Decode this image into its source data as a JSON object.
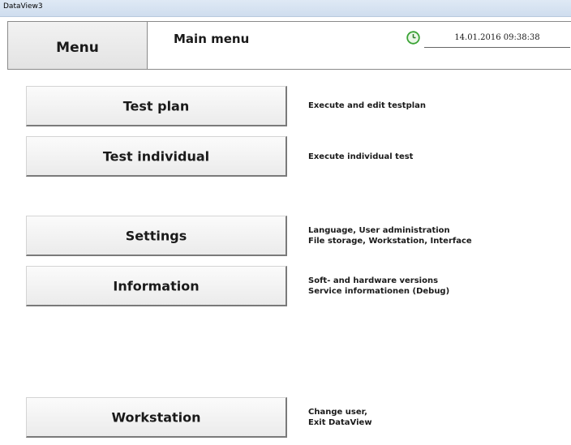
{
  "window": {
    "title": "DataView3"
  },
  "header": {
    "menu_label": "Menu",
    "title": "Main menu",
    "datetime": "14.01.2016  09:38:38"
  },
  "buttons": [
    {
      "label": "Test plan",
      "desc": [
        "Execute and edit testplan"
      ]
    },
    {
      "label": "Test individual",
      "desc": [
        "Execute individual test"
      ]
    },
    {
      "label": "Settings",
      "desc": [
        "Language, User administration",
        "File storage, Workstation, Interface"
      ]
    },
    {
      "label": "Information",
      "desc": [
        "Soft- and hardware versions",
        "Service informationen (Debug)"
      ]
    },
    {
      "label": "Workstation",
      "desc": [
        "Change user,",
        "Exit DataView"
      ]
    }
  ],
  "colors": {
    "clock": "#3aa335",
    "button_shadow": "#7a7a7a"
  }
}
